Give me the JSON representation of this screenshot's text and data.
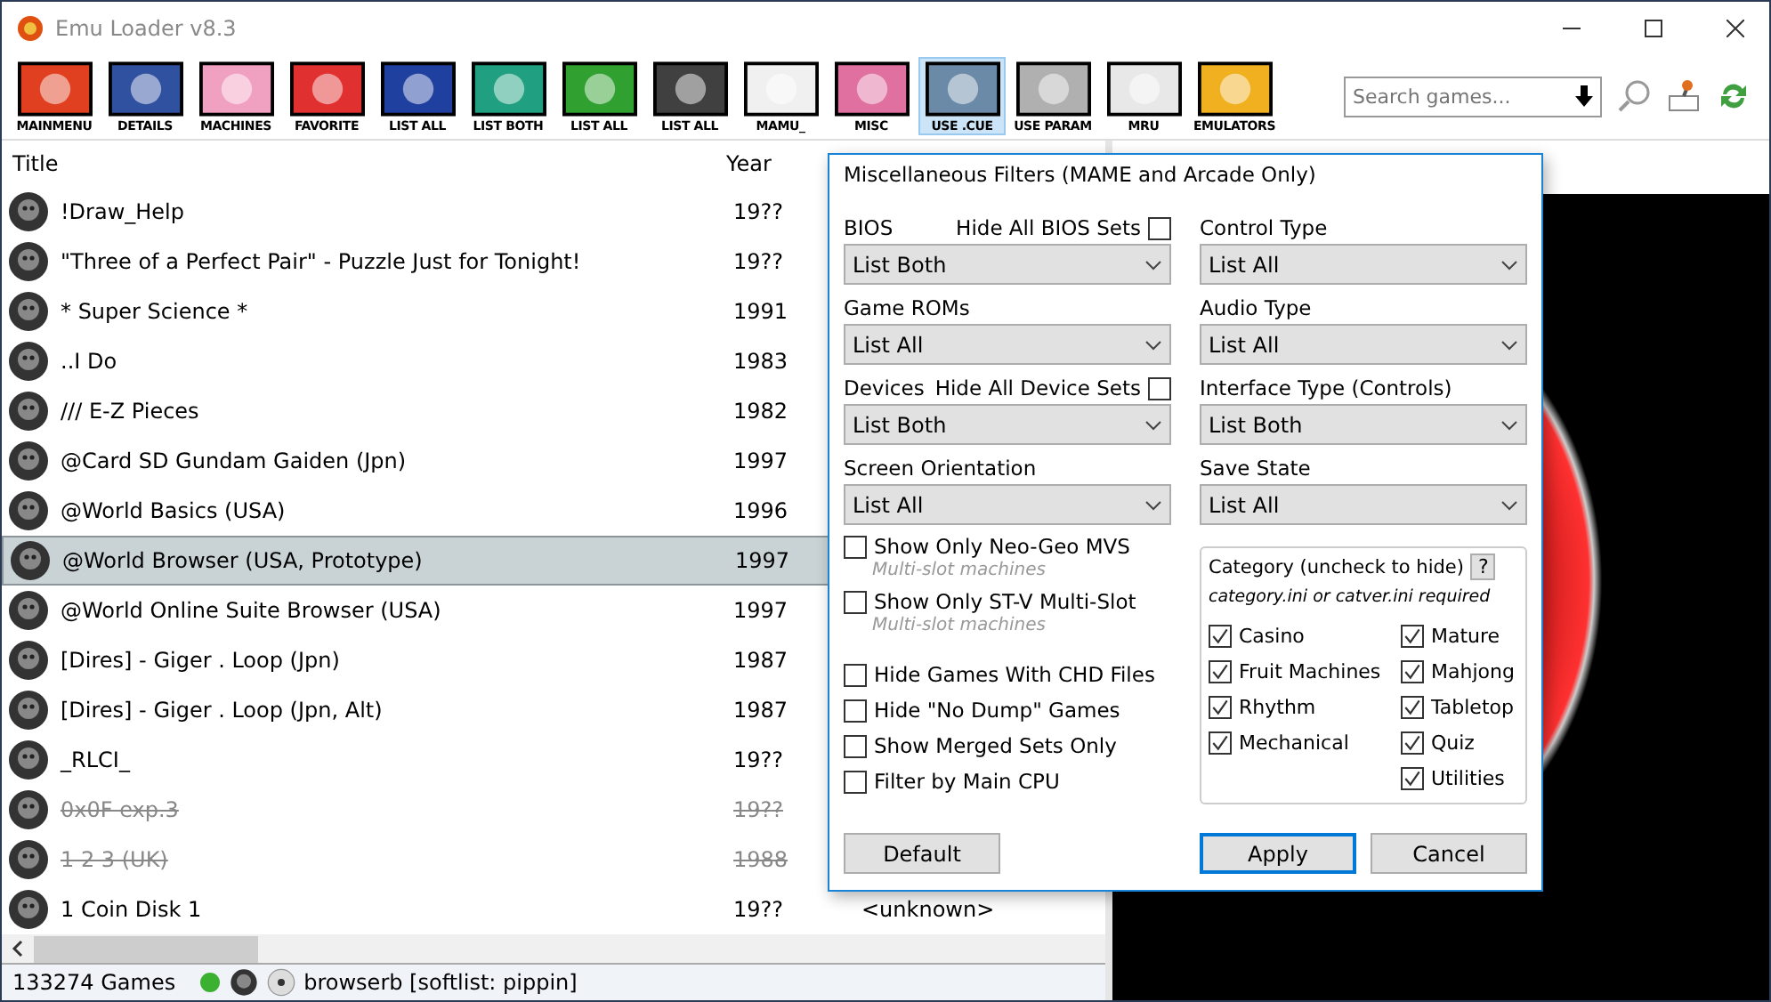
{
  "window": {
    "title": "Emu Loader v8.3"
  },
  "toolbar": [
    {
      "label": "MAINMENU",
      "selected": false
    },
    {
      "label": "DETAILS",
      "selected": false
    },
    {
      "label": "MACHINES",
      "selected": false
    },
    {
      "label": "FAVORITE",
      "selected": false
    },
    {
      "label": "LIST ALL",
      "selected": false
    },
    {
      "label": "LIST BOTH",
      "selected": false
    },
    {
      "label": "LIST ALL",
      "selected": false
    },
    {
      "label": "LIST ALL",
      "selected": false
    },
    {
      "label": "MAMU_",
      "selected": false
    },
    {
      "label": "MISC",
      "selected": false
    },
    {
      "label": "USE .CUE",
      "selected": true
    },
    {
      "label": "USE PARAM",
      "selected": false
    },
    {
      "label": "MRU",
      "selected": false
    },
    {
      "label": "EMULATORS",
      "selected": false
    }
  ],
  "search": {
    "placeholder": "Search games..."
  },
  "table": {
    "columns": [
      "Title",
      "Year"
    ],
    "rows": [
      {
        "title": "!Draw_Help",
        "year": "19??",
        "selected": false,
        "struck": false
      },
      {
        "title": "\"Three of a Perfect Pair\" - Puzzle Just for Tonight!",
        "year": "19??",
        "selected": false,
        "struck": false
      },
      {
        "title": "* Super Science *",
        "year": "1991",
        "selected": false,
        "struck": false
      },
      {
        "title": "..I Do",
        "year": "1983",
        "selected": false,
        "struck": false
      },
      {
        "title": "/// E-Z Pieces",
        "year": "1982",
        "selected": false,
        "struck": false
      },
      {
        "title": "@Card SD Gundam Gaiden (Jpn)",
        "year": "1997",
        "selected": false,
        "struck": false
      },
      {
        "title": "@World Basics (USA)",
        "year": "1996",
        "selected": false,
        "struck": false
      },
      {
        "title": "@World Browser (USA, Prototype)",
        "year": "1997",
        "selected": true,
        "struck": false
      },
      {
        "title": "@World Online Suite Browser (USA)",
        "year": "1997",
        "selected": false,
        "struck": false
      },
      {
        "title": "[Dires] - Giger . Loop (Jpn)",
        "year": "1987",
        "selected": false,
        "struck": false
      },
      {
        "title": "[Dires] - Giger . Loop (Jpn, Alt)",
        "year": "1987",
        "selected": false,
        "struck": false
      },
      {
        "title": "_RLCI_",
        "year": "19??",
        "selected": false,
        "struck": false
      },
      {
        "title": "0x0F exp.3",
        "year": "19??",
        "selected": false,
        "struck": true
      },
      {
        "title": "1 2 3 (UK)",
        "year": "1988",
        "selected": false,
        "struck": true
      },
      {
        "title": "1 Coin Disk 1",
        "year": "19??",
        "selected": false,
        "struck": false,
        "column_3": "<unknown>"
      }
    ]
  },
  "status_bar": {
    "count": "133274 Games",
    "text": "browserb [softlist: pippin]"
  },
  "dialog": {
    "title": "Miscellaneous Filters (MAME and Arcade Only)",
    "left_filters": [
      {
        "label": "BIOS",
        "hide_label": "Hide All BIOS Sets",
        "hide_checked": false,
        "value": "List Both"
      },
      {
        "label": "Game ROMs",
        "value": "List All"
      },
      {
        "label": "Devices",
        "hide_label": "Hide All Device Sets",
        "hide_checked": false,
        "value": "List Both"
      },
      {
        "label": "Screen Orientation",
        "value": "List All"
      }
    ],
    "options": [
      {
        "label": "Show Only Neo-Geo MVS",
        "note": "Multi-slot machines",
        "checked": false
      },
      {
        "label": "Show Only ST-V Multi-Slot",
        "note": "Multi-slot machines",
        "checked": false
      },
      {
        "label": "Hide Games With CHD Files",
        "checked": false
      },
      {
        "label": "Hide \"No Dump\" Games",
        "checked": false
      },
      {
        "label": "Show Merged Sets Only",
        "checked": false
      },
      {
        "label": "Filter by Main CPU",
        "checked": false
      }
    ],
    "right_filters": [
      {
        "label": "Control Type",
        "value": "List All"
      },
      {
        "label": "Audio Type",
        "value": "List All"
      },
      {
        "label": "Interface Type (Controls)",
        "value": "List Both"
      },
      {
        "label": "Save State",
        "value": "List All"
      }
    ],
    "category": {
      "title": "Category (uncheck to hide)",
      "help": "?",
      "note": "category.ini or catver.ini required",
      "items_left": [
        {
          "label": "Casino",
          "checked": true
        },
        {
          "label": "Fruit Machines",
          "checked": true
        },
        {
          "label": "Rhythm",
          "checked": true
        },
        {
          "label": "Mechanical",
          "checked": true
        }
      ],
      "items_right": [
        {
          "label": "Mature",
          "checked": true
        },
        {
          "label": "Mahjong",
          "checked": true
        },
        {
          "label": "Tabletop",
          "checked": true
        },
        {
          "label": "Quiz",
          "checked": true
        },
        {
          "label": "Utilities",
          "checked": true
        }
      ]
    },
    "buttons": [
      {
        "label": "Default",
        "kind": "normal"
      },
      {
        "label": "Apply",
        "kind": "default"
      },
      {
        "label": "Cancel",
        "kind": "normal"
      }
    ]
  }
}
